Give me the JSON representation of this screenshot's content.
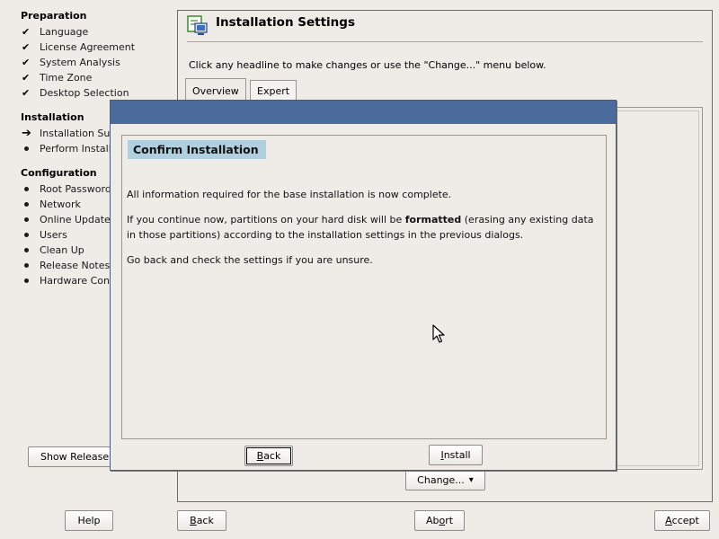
{
  "sidebar": {
    "sections": [
      {
        "title": "Preparation",
        "steps": [
          {
            "label": "Language",
            "state": "done"
          },
          {
            "label": "License Agreement",
            "state": "done"
          },
          {
            "label": "System Analysis",
            "state": "done"
          },
          {
            "label": "Time Zone",
            "state": "done"
          },
          {
            "label": "Desktop Selection",
            "state": "done"
          }
        ]
      },
      {
        "title": "Installation",
        "steps": [
          {
            "label": "Installation Sur",
            "state": "current"
          },
          {
            "label": "Perform Installa",
            "state": "pending"
          }
        ]
      },
      {
        "title": "Configuration",
        "steps": [
          {
            "label": "Root Password",
            "state": "pending"
          },
          {
            "label": "Network",
            "state": "pending"
          },
          {
            "label": "Online Update",
            "state": "pending"
          },
          {
            "label": "Users",
            "state": "pending"
          },
          {
            "label": "Clean Up",
            "state": "pending"
          },
          {
            "label": "Release Notes",
            "state": "pending"
          },
          {
            "label": "Hardware Con",
            "state": "pending"
          }
        ]
      }
    ],
    "show_release_label": "Show Release"
  },
  "main": {
    "title": "Installation Settings",
    "instruction": "Click any headline to make changes or use the \"Change...\" menu below.",
    "tabs": [
      {
        "label": "Overview",
        "active": true
      },
      {
        "label": "Expert",
        "active": false
      }
    ],
    "change_label": "Change...",
    "change_arrow": "▾"
  },
  "dialog": {
    "heading": "Confirm Installation",
    "para1": "All information required for the base installation is now complete.",
    "para2_before": "If you continue now, partitions on your hard disk will be ",
    "para2_bold": "formatted",
    "para2_after": " (erasing any existing data in those partitions) according to the installation settings in the previous dialogs.",
    "para3": "Go back and check the settings if you are unsure.",
    "back": {
      "mnemonic": "B",
      "rest": "ack"
    },
    "install": {
      "mnemonic": "I",
      "rest": "nstall"
    }
  },
  "footer": {
    "help_label": "Help",
    "back": {
      "mnemonic": "B",
      "rest": "ack"
    },
    "abort": {
      "before": "Ab",
      "mnemonic": "o",
      "after": "rt"
    },
    "accept": {
      "mnemonic": "A",
      "rest": "ccept"
    }
  },
  "colors": {
    "dialog_titlebar": "#4a6b9b",
    "heading_bg": "#b0d0df",
    "window_bg": "#efebe7"
  },
  "icons": {
    "check": "✔",
    "arrow": "➔",
    "page_icon": "installation-settings-icon"
  }
}
